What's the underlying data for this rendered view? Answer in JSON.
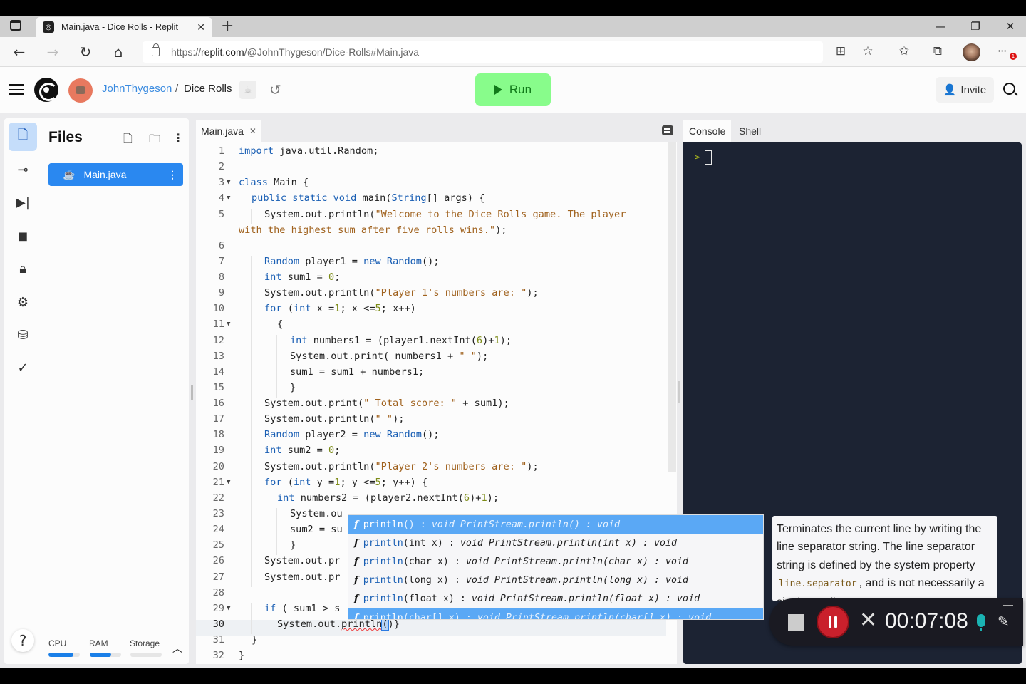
{
  "browser": {
    "tab_title": "Main.java - Dice Rolls - Replit",
    "url_prefix": "https://",
    "url_host": "replit.com",
    "url_path": "/@JohnThygeson/Dice-Rolls#Main.java",
    "new_tab_label": "+",
    "notification_count": "1"
  },
  "header": {
    "owner": "JohnThygeson",
    "separator": "/",
    "project": "Dice Rolls",
    "run_label": "Run",
    "invite_label": "Invite"
  },
  "sidebar": {
    "title": "Files",
    "rail_icons": [
      "files-icon",
      "git-icon",
      "debugger-icon",
      "packages-icon",
      "secrets-icon",
      "settings-icon",
      "database-icon",
      "unit-tests-icon"
    ],
    "files": [
      {
        "name": "Main.java",
        "selected": true
      }
    ],
    "resources": [
      {
        "label": "CPU",
        "usage": 0.8
      },
      {
        "label": "RAM",
        "usage": 0.68
      },
      {
        "label": "Storage",
        "usage": 0.0
      }
    ],
    "help_label": "?"
  },
  "editor": {
    "tab_label": "Main.java",
    "active_line": 30,
    "lines": [
      {
        "n": "1",
        "fold": false,
        "indent": 0,
        "html": "<span class='k'>import</span> java.util.Random;"
      },
      {
        "n": "2",
        "fold": false,
        "indent": 0,
        "html": ""
      },
      {
        "n": "3",
        "fold": true,
        "indent": 0,
        "html": "<span class='k'>class</span> Main {"
      },
      {
        "n": "4",
        "fold": true,
        "indent": 1,
        "html": "<span class='k'>public</span> <span class='k'>static</span> <span class='k'>void</span> main(<span class='t'>String</span>[] args) {"
      },
      {
        "n": "5",
        "fold": false,
        "indent": 2,
        "html": "System.out.println(<span class='s'>\"Welcome to the Dice Rolls game. The player</span>"
      },
      {
        "n": "",
        "fold": false,
        "indent": 0,
        "html": "<span class='s'>with the highest sum after five rolls wins.\"</span>);"
      },
      {
        "n": "6",
        "fold": false,
        "indent": 0,
        "html": ""
      },
      {
        "n": "7",
        "fold": false,
        "indent": 2,
        "html": "<span class='t'>Random</span> player1 = <span class='k'>new</span> <span class='t'>Random</span>();"
      },
      {
        "n": "8",
        "fold": false,
        "indent": 2,
        "html": "<span class='k'>int</span> sum1 = <span class='n'>0</span>;"
      },
      {
        "n": "9",
        "fold": false,
        "indent": 2,
        "html": "System.out.println(<span class='s'>\"Player 1's numbers are: \"</span>);"
      },
      {
        "n": "10",
        "fold": false,
        "indent": 2,
        "html": "<span class='k'>for</span> (<span class='k'>int</span> x =<span class='n'>1</span>; x &lt;=<span class='n'>5</span>; x++)"
      },
      {
        "n": "11",
        "fold": true,
        "indent": 3,
        "html": "{"
      },
      {
        "n": "12",
        "fold": false,
        "indent": 4,
        "html": "<span class='k'>int</span> numbers1 = (player1.nextInt(<span class='n'>6</span>)+<span class='n'>1</span>);"
      },
      {
        "n": "13",
        "fold": false,
        "indent": 4,
        "html": "System.out.print( numbers1 + <span class='s'>\" \"</span>);"
      },
      {
        "n": "14",
        "fold": false,
        "indent": 4,
        "html": "sum1 = sum1 + numbers1;"
      },
      {
        "n": "15",
        "fold": false,
        "indent": 4,
        "html": "}"
      },
      {
        "n": "16",
        "fold": false,
        "indent": 2,
        "html": "System.out.print(<span class='s'>\" Total score: \"</span> + sum1);"
      },
      {
        "n": "17",
        "fold": false,
        "indent": 2,
        "html": "System.out.println(<span class='s'>\" \"</span>);"
      },
      {
        "n": "18",
        "fold": false,
        "indent": 2,
        "html": "<span class='t'>Random</span> player2 = <span class='k'>new</span> <span class='t'>Random</span>();"
      },
      {
        "n": "19",
        "fold": false,
        "indent": 2,
        "html": "<span class='k'>int</span> sum2 = <span class='n'>0</span>;"
      },
      {
        "n": "20",
        "fold": false,
        "indent": 2,
        "html": "System.out.println(<span class='s'>\"Player 2's numbers are: \"</span>);"
      },
      {
        "n": "21",
        "fold": true,
        "indent": 2,
        "html": "<span class='k'>for</span> (<span class='k'>int</span> y =<span class='n'>1</span>; y &lt;=<span class='n'>5</span>; y++) {"
      },
      {
        "n": "22",
        "fold": false,
        "indent": 3,
        "html": "<span class='k'>int</span> numbers2 = (player2.nextInt(<span class='n'>6</span>)+<span class='n'>1</span>);"
      },
      {
        "n": "23",
        "fold": false,
        "indent": 4,
        "html": "System.ou"
      },
      {
        "n": "24",
        "fold": false,
        "indent": 4,
        "html": "sum2 = su"
      },
      {
        "n": "25",
        "fold": false,
        "indent": 4,
        "html": "}"
      },
      {
        "n": "26",
        "fold": false,
        "indent": 2,
        "html": "System.out.pr"
      },
      {
        "n": "27",
        "fold": false,
        "indent": 2,
        "html": "System.out.pr"
      },
      {
        "n": "28",
        "fold": false,
        "indent": 0,
        "html": ""
      },
      {
        "n": "29",
        "fold": true,
        "indent": 2,
        "html": "<span class='k'>if</span> ( sum1 &gt; s"
      },
      {
        "n": "30",
        "fold": false,
        "indent": 3,
        "html": "System.out.<span class='squig'>printl</span><span class='squig'>n</span><span class='cursorsel'>(</span>)}"
      },
      {
        "n": "31",
        "fold": false,
        "indent": 1,
        "html": "}"
      },
      {
        "n": "32",
        "fold": false,
        "indent": 0,
        "html": "}"
      }
    ]
  },
  "autocomplete": {
    "items": [
      {
        "name": "println",
        "params": "()",
        "signature": "void PrintStream.println() : void",
        "selected": true
      },
      {
        "name": "println",
        "params": "(int x)",
        "signature": "void PrintStream.println(int x) : void",
        "selected": false
      },
      {
        "name": "println",
        "params": "(char x)",
        "signature": "void PrintStream.println(char x) : void",
        "selected": false
      },
      {
        "name": "println",
        "params": "(long x)",
        "signature": "void PrintStream.println(long x) : void",
        "selected": false
      },
      {
        "name": "println",
        "params": "(float x)",
        "signature": "void PrintStream.println(float x) : void",
        "selected": false
      },
      {
        "name": "println",
        "params": "(char[] x)",
        "signature": "void PrintStream.println(char[] x) : void",
        "selected": false
      }
    ],
    "doc_before": "Terminates the current line by writing the line separator string. The line separator string is defined by the system property",
    "doc_code": "line.separator",
    "doc_after": ", and is not necessarily a single newline"
  },
  "console": {
    "tabs": [
      "Console",
      "Shell"
    ],
    "active_tab": "Console",
    "prompt": ">"
  },
  "recorder": {
    "elapsed": "00:07:08"
  }
}
